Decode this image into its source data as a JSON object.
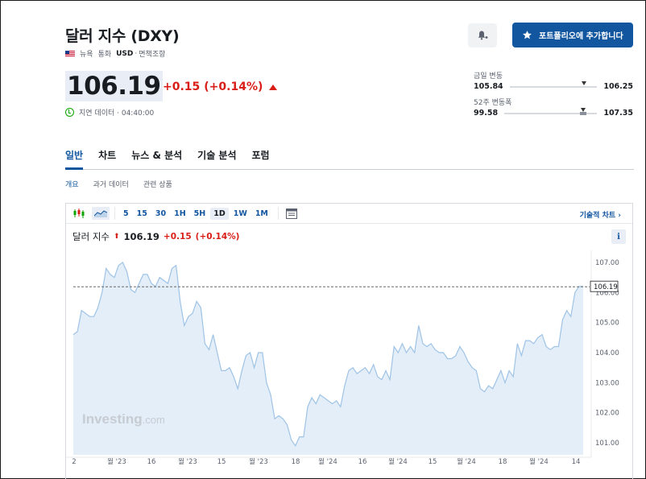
{
  "header": {
    "title": "달러 지수 (DXY)",
    "exchange": "뉴욕",
    "currency_label": "통화",
    "currency": "USD",
    "disclaimer": "면책조항"
  },
  "buttons": {
    "alert_icon": "bell-plus-icon",
    "add_portfolio": "포트폴리오에 추가합니다"
  },
  "quote": {
    "price": "106.19",
    "change": "+0.15",
    "change_pct": "(+0.14%)",
    "delay_text": "지연 데이터 · 04:40:00"
  },
  "ranges": {
    "daily": {
      "label": "금일 변동",
      "low": "105.84",
      "high": "106.25",
      "current": 106.19
    },
    "week52": {
      "label": "52주 변동폭",
      "low": "99.58",
      "high": "107.35",
      "current": 106.19
    }
  },
  "tabs": [
    "일반",
    "차트",
    "뉴스 & 분석",
    "기술 분석",
    "포럼"
  ],
  "subtabs": [
    "개요",
    "과거 데이터",
    "관련 상품"
  ],
  "chart_toolbar": {
    "timeframes": [
      "5",
      "15",
      "30",
      "1H",
      "5H",
      "1D",
      "1W",
      "1M"
    ],
    "active_timeframe": "1D",
    "tech_chart_link": "기술적 차트 ›"
  },
  "chart_legend": {
    "name": "달러 지수",
    "arrow": "⬆",
    "value": "106.19",
    "change": "+0.15",
    "change_pct": "(+0.14%)",
    "info": "i"
  },
  "watermark": {
    "brand": "Investing",
    "suffix": ".com"
  },
  "colors": {
    "accent": "#1256a0",
    "down_red": "#d91e18",
    "line": "#9ec3e6",
    "area": "#e4eef8"
  },
  "chart_data": {
    "type": "area",
    "y_ticks": [
      "107.00",
      "106.00",
      "105.00",
      "104.00",
      "103.00",
      "102.00",
      "101.00"
    ],
    "ylim": [
      100.6,
      107.4
    ],
    "current_label": "106.19",
    "current_value": 106.19,
    "x_ticks": [
      "2",
      "월 '23",
      "16",
      "월 '23",
      "15",
      "월 '23",
      "18",
      "월 '24",
      "16",
      "월 '24",
      "15",
      "월 '24",
      "18",
      "월 '24",
      "14"
    ],
    "values": [
      104.6,
      104.7,
      105.4,
      105.3,
      105.2,
      105.2,
      105.5,
      106.0,
      106.8,
      106.6,
      106.5,
      106.9,
      107.0,
      106.7,
      106.1,
      106.0,
      106.3,
      106.6,
      106.6,
      106.3,
      106.2,
      106.5,
      106.4,
      106.3,
      106.8,
      106.9,
      105.7,
      104.9,
      105.2,
      105.3,
      105.7,
      105.5,
      104.3,
      104.1,
      104.6,
      104.0,
      103.4,
      103.4,
      103.5,
      103.2,
      102.8,
      103.4,
      103.9,
      104.0,
      103.5,
      104.0,
      104.0,
      103.0,
      102.6,
      101.8,
      101.9,
      101.8,
      101.6,
      101.1,
      100.9,
      101.2,
      101.2,
      102.2,
      102.5,
      102.3,
      102.6,
      102.5,
      102.4,
      102.3,
      102.4,
      102.2,
      102.9,
      103.4,
      103.5,
      103.3,
      103.4,
      103.5,
      103.3,
      103.6,
      103.2,
      103.1,
      103.4,
      103.1,
      104.2,
      104.0,
      104.3,
      104.0,
      104.2,
      104.0,
      104.9,
      104.3,
      104.2,
      104.3,
      104.1,
      104.0,
      104.0,
      103.8,
      103.8,
      103.9,
      104.2,
      104.0,
      103.7,
      103.5,
      103.4,
      102.8,
      102.7,
      102.9,
      102.8,
      103.1,
      103.4,
      103.0,
      103.4,
      103.2,
      104.3,
      103.9,
      104.4,
      104.4,
      104.3,
      104.5,
      104.6,
      104.2,
      104.1,
      104.2,
      104.2,
      105.1,
      105.4,
      105.2,
      106.0,
      106.2,
      106.2
    ]
  }
}
